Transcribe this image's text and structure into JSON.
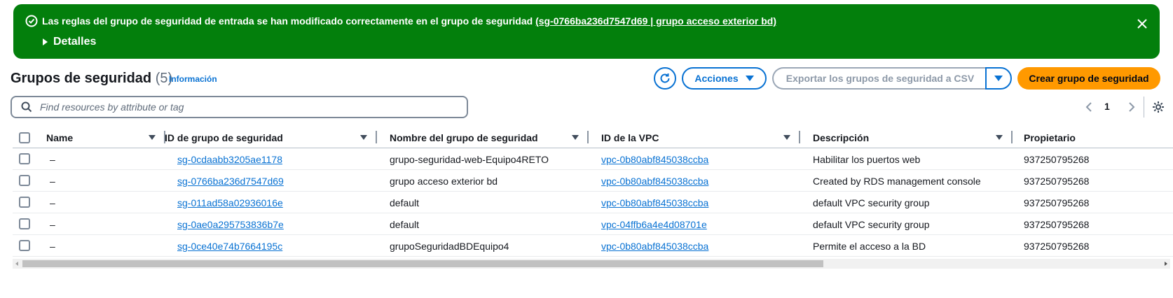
{
  "flash": {
    "message": "Las reglas del grupo de seguridad de entrada se han modificado correctamente en el grupo de seguridad ",
    "link": "(sg-0766ba236d7547d69 | grupo acceso exterior bd)",
    "details_label": "Detalles",
    "color": "#037f0c"
  },
  "header": {
    "title": "Grupos de seguridad",
    "count": "(5)",
    "info_link": "Información"
  },
  "actions": {
    "acciones_label": "Acciones",
    "export_label": "Exportar los grupos de seguridad a CSV",
    "create_label": "Crear grupo de seguridad",
    "primary_color": "#ff9900",
    "link_color": "#0972d3"
  },
  "search": {
    "placeholder": "Find resources by attribute or tag",
    "value": ""
  },
  "pagination": {
    "current_page": "1"
  },
  "table": {
    "columns": [
      "Name",
      "ID de grupo de seguridad",
      "Nombre del grupo de seguridad",
      "ID de la VPC",
      "Descripción",
      "Propietario"
    ],
    "rows": [
      {
        "name": "–",
        "sg_id": "sg-0cdaabb3205ae1178",
        "sg_name": "grupo-seguridad-web-Equipo4RETO",
        "vpc_id": "vpc-0b80abf845038ccba",
        "description": "Habilitar los puertos web",
        "owner": "937250795268"
      },
      {
        "name": "–",
        "sg_id": "sg-0766ba236d7547d69",
        "sg_name": "grupo acceso exterior bd",
        "vpc_id": "vpc-0b80abf845038ccba",
        "description": "Created by RDS management console",
        "owner": "937250795268"
      },
      {
        "name": "–",
        "sg_id": "sg-011ad58a02936016e",
        "sg_name": "default",
        "vpc_id": "vpc-0b80abf845038ccba",
        "description": "default VPC security group",
        "owner": "937250795268"
      },
      {
        "name": "–",
        "sg_id": "sg-0ae0a295753836b7e",
        "sg_name": "default",
        "vpc_id": "vpc-04ffb6a4e4d08701e",
        "description": "default VPC security group",
        "owner": "937250795268"
      },
      {
        "name": "–",
        "sg_id": "sg-0ce40e74b7664195c",
        "sg_name": "grupoSeguridadBDEquipo4",
        "vpc_id": "vpc-0b80abf845038ccba",
        "description": "Permite el acceso a la BD",
        "owner": "937250795268"
      }
    ]
  }
}
